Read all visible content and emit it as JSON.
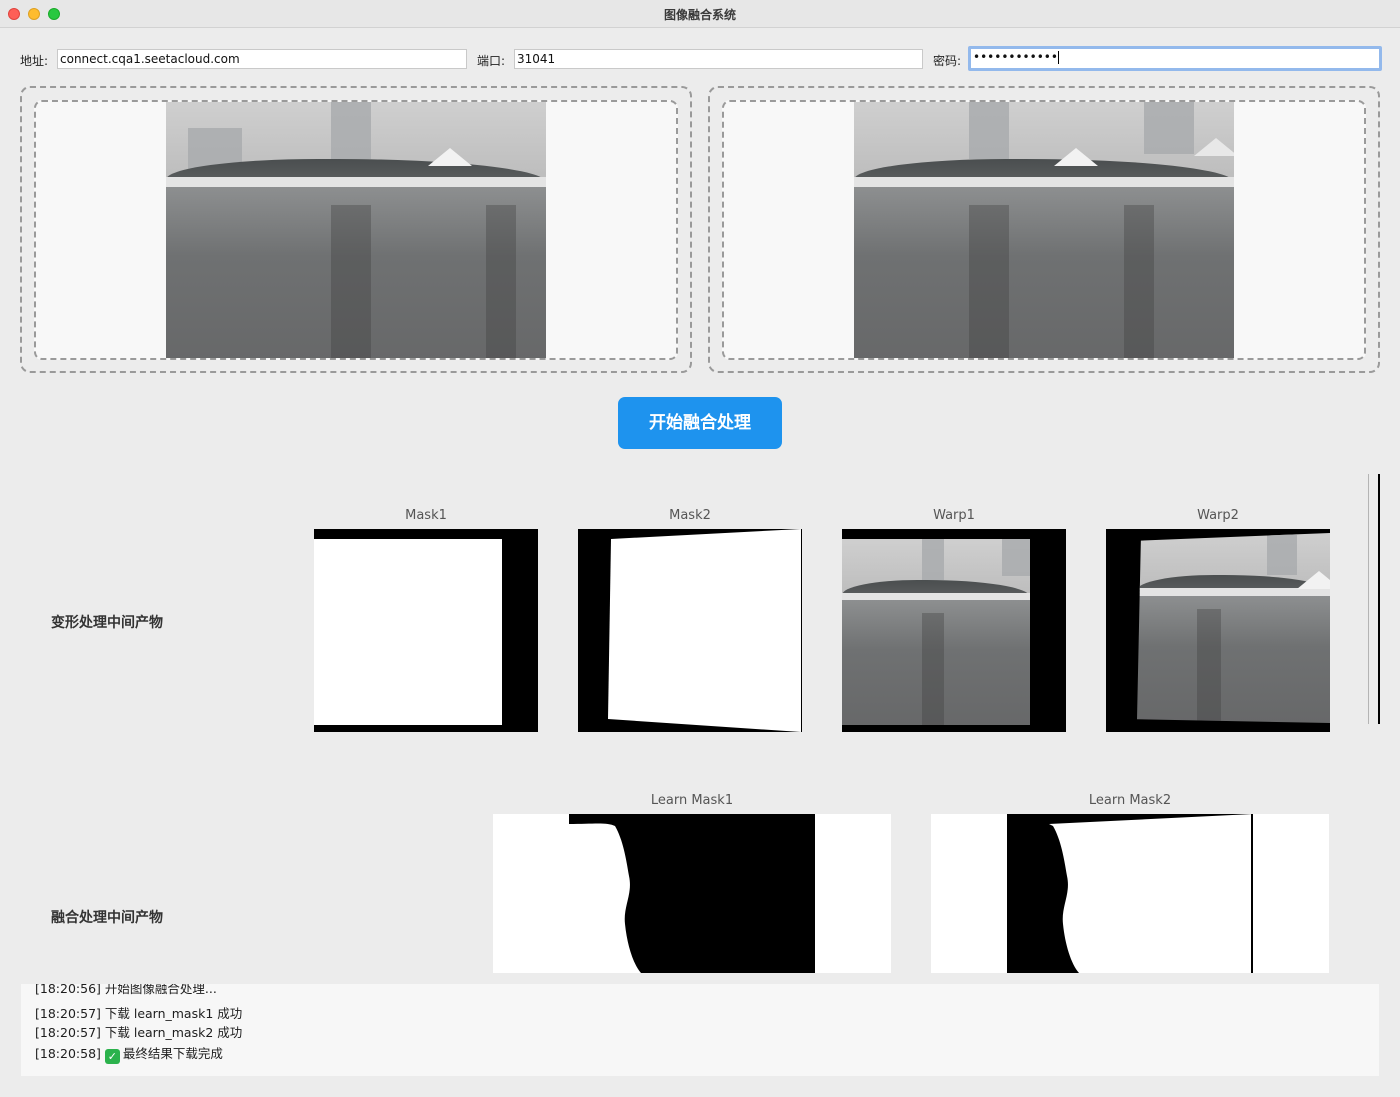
{
  "window": {
    "title": "图像融合系统"
  },
  "connection": {
    "address_label": "地址:",
    "address_value": "connect.cqa1.seetacloud.com",
    "port_label": "端口:",
    "port_value": "31041",
    "password_label": "密码:",
    "password_value": "••••••••••••"
  },
  "actions": {
    "start_label": "开始融合处理"
  },
  "warp_section": {
    "label": "变形处理中间产物",
    "items": [
      {
        "caption": "Mask1"
      },
      {
        "caption": "Mask2"
      },
      {
        "caption": "Warp1"
      },
      {
        "caption": "Warp2"
      }
    ]
  },
  "fusion_section": {
    "label": "融合处理中间产物",
    "items": [
      {
        "caption": "Learn Mask1"
      },
      {
        "caption": "Learn Mask2"
      }
    ]
  },
  "log": {
    "lines": [
      "[18:20:56] 开始图像融合处理...",
      "[18:20:57] 下载 learn_mask1 成功",
      "[18:20:57] 下载 learn_mask2 成功",
      "[18:20:58]",
      "最终结果下载完成"
    ],
    "check_glyph": "✓"
  }
}
